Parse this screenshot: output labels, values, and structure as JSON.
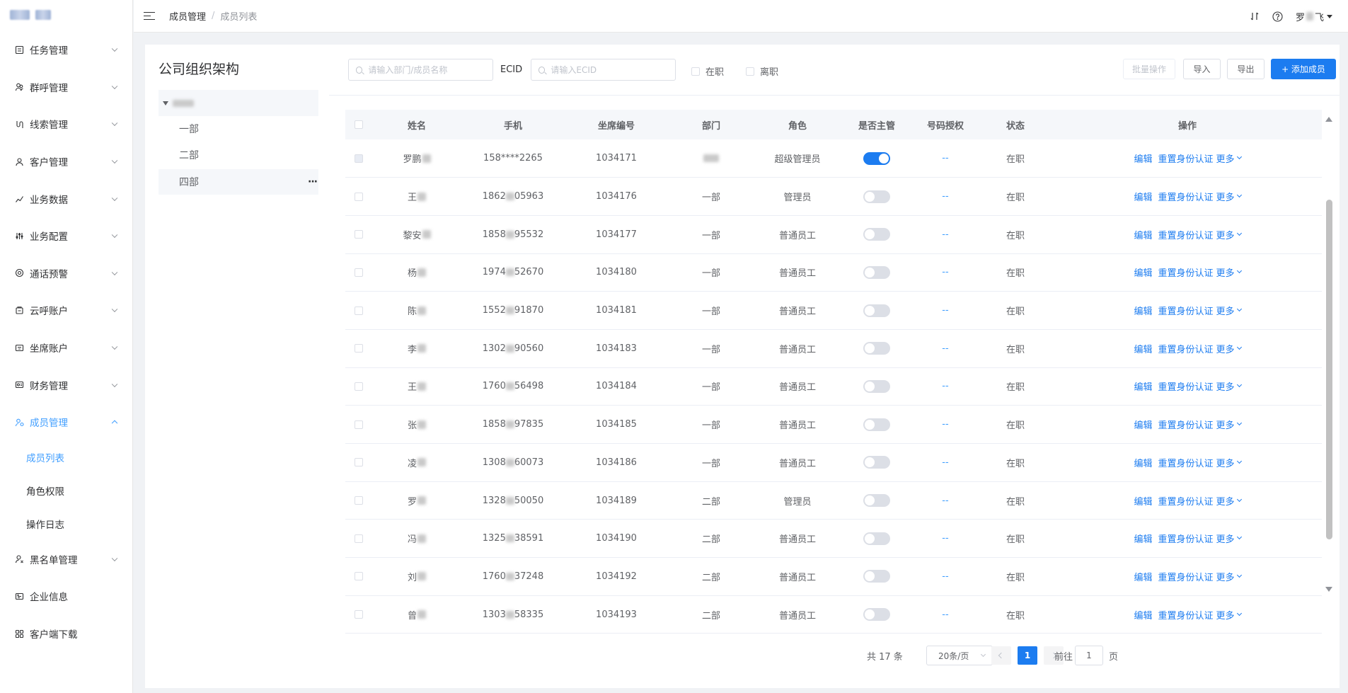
{
  "sidebar": {
    "items": [
      {
        "label": "任务管理",
        "icon": "list-icon"
      },
      {
        "label": "群呼管理",
        "icon": "group-icon"
      },
      {
        "label": "线索管理",
        "icon": "route-icon"
      },
      {
        "label": "客户管理",
        "icon": "customer-icon"
      },
      {
        "label": "业务数据",
        "icon": "chart-icon"
      },
      {
        "label": "业务配置",
        "icon": "sliders-icon"
      },
      {
        "label": "通话预警",
        "icon": "alert-icon"
      },
      {
        "label": "云呼账户",
        "icon": "cloud-account-icon"
      },
      {
        "label": "坐席账户",
        "icon": "seat-account-icon"
      },
      {
        "label": "财务管理",
        "icon": "finance-icon"
      },
      {
        "label": "成员管理",
        "icon": "member-icon"
      },
      {
        "label": "黑名单管理",
        "icon": "blacklist-icon"
      },
      {
        "label": "企业信息",
        "icon": "company-icon"
      },
      {
        "label": "客户端下载",
        "icon": "download-icon"
      }
    ],
    "sub_items": [
      "成员列表",
      "角色权限",
      "操作日志"
    ]
  },
  "breadcrumb": {
    "parent": "成员管理",
    "separator": "/",
    "current": "成员列表"
  },
  "user": {
    "name_prefix": "罗",
    "name_suffix": "飞"
  },
  "tree": {
    "title": "公司组织架构",
    "nodes": [
      "一部",
      "二部",
      "四部"
    ],
    "more": "···"
  },
  "toolbar": {
    "search_placeholder": "请输入部门/成员名称",
    "ecid_label": "ECID",
    "ecid_placeholder": "请输入ECID",
    "filter_active": "在职",
    "filter_left": "离职",
    "batch": "批量操作",
    "import": "导入",
    "export": "导出",
    "add": "+ 添加成员"
  },
  "table": {
    "headers": [
      "姓名",
      "手机",
      "坐席编号",
      "部门",
      "角色",
      "是否主管",
      "号码授权",
      "状态",
      "操作"
    ],
    "rows": [
      {
        "name": "罗鹏",
        "phone_a": "158****2265",
        "phone_b": "",
        "seat": "1034171",
        "dept": "",
        "role": "超级管理员",
        "manager": true,
        "auth": "--",
        "status": "在职"
      },
      {
        "name": "王",
        "phone_a": "1862",
        "phone_b": "05963",
        "seat": "1034176",
        "dept": "一部",
        "role": "管理员",
        "manager": false,
        "auth": "--",
        "status": "在职"
      },
      {
        "name": "黎安",
        "phone_a": "1858",
        "phone_b": "95532",
        "seat": "1034177",
        "dept": "一部",
        "role": "普通员工",
        "manager": false,
        "auth": "--",
        "status": "在职"
      },
      {
        "name": "杨",
        "phone_a": "1974",
        "phone_b": "52670",
        "seat": "1034180",
        "dept": "一部",
        "role": "普通员工",
        "manager": false,
        "auth": "--",
        "status": "在职"
      },
      {
        "name": "陈",
        "phone_a": "1552",
        "phone_b": "91870",
        "seat": "1034181",
        "dept": "一部",
        "role": "普通员工",
        "manager": false,
        "auth": "--",
        "status": "在职"
      },
      {
        "name": "李",
        "phone_a": "1302",
        "phone_b": "90560",
        "seat": "1034183",
        "dept": "一部",
        "role": "普通员工",
        "manager": false,
        "auth": "--",
        "status": "在职"
      },
      {
        "name": "王",
        "phone_a": "1760",
        "phone_b": "56498",
        "seat": "1034184",
        "dept": "一部",
        "role": "普通员工",
        "manager": false,
        "auth": "--",
        "status": "在职"
      },
      {
        "name": "张",
        "phone_a": "1858",
        "phone_b": "97835",
        "seat": "1034185",
        "dept": "一部",
        "role": "普通员工",
        "manager": false,
        "auth": "--",
        "status": "在职"
      },
      {
        "name": "凌",
        "phone_a": "1308",
        "phone_b": "60073",
        "seat": "1034186",
        "dept": "一部",
        "role": "普通员工",
        "manager": false,
        "auth": "--",
        "status": "在职"
      },
      {
        "name": "罗",
        "phone_a": "1328",
        "phone_b": "50050",
        "seat": "1034189",
        "dept": "二部",
        "role": "管理员",
        "manager": false,
        "auth": "--",
        "status": "在职"
      },
      {
        "name": "冯",
        "phone_a": "1325",
        "phone_b": "38591",
        "seat": "1034190",
        "dept": "二部",
        "role": "普通员工",
        "manager": false,
        "auth": "--",
        "status": "在职"
      },
      {
        "name": "刘",
        "phone_a": "1760",
        "phone_b": "37248",
        "seat": "1034192",
        "dept": "二部",
        "role": "普通员工",
        "manager": false,
        "auth": "--",
        "status": "在职"
      },
      {
        "name": "曾",
        "phone_a": "1303",
        "phone_b": "58335",
        "seat": "1034193",
        "dept": "二部",
        "role": "普通员工",
        "manager": false,
        "auth": "--",
        "status": "在职"
      }
    ],
    "actions": {
      "edit": "编辑",
      "reset": "重置身份认证",
      "more": "更多"
    }
  },
  "pagination": {
    "total": "共 17 条",
    "page_size": "20条/页",
    "current_page": "1",
    "goto_label": "前往",
    "goto_value": "1",
    "page_suffix": "页"
  },
  "colors": {
    "accent": "#1c7cf0",
    "link": "#409eff"
  }
}
